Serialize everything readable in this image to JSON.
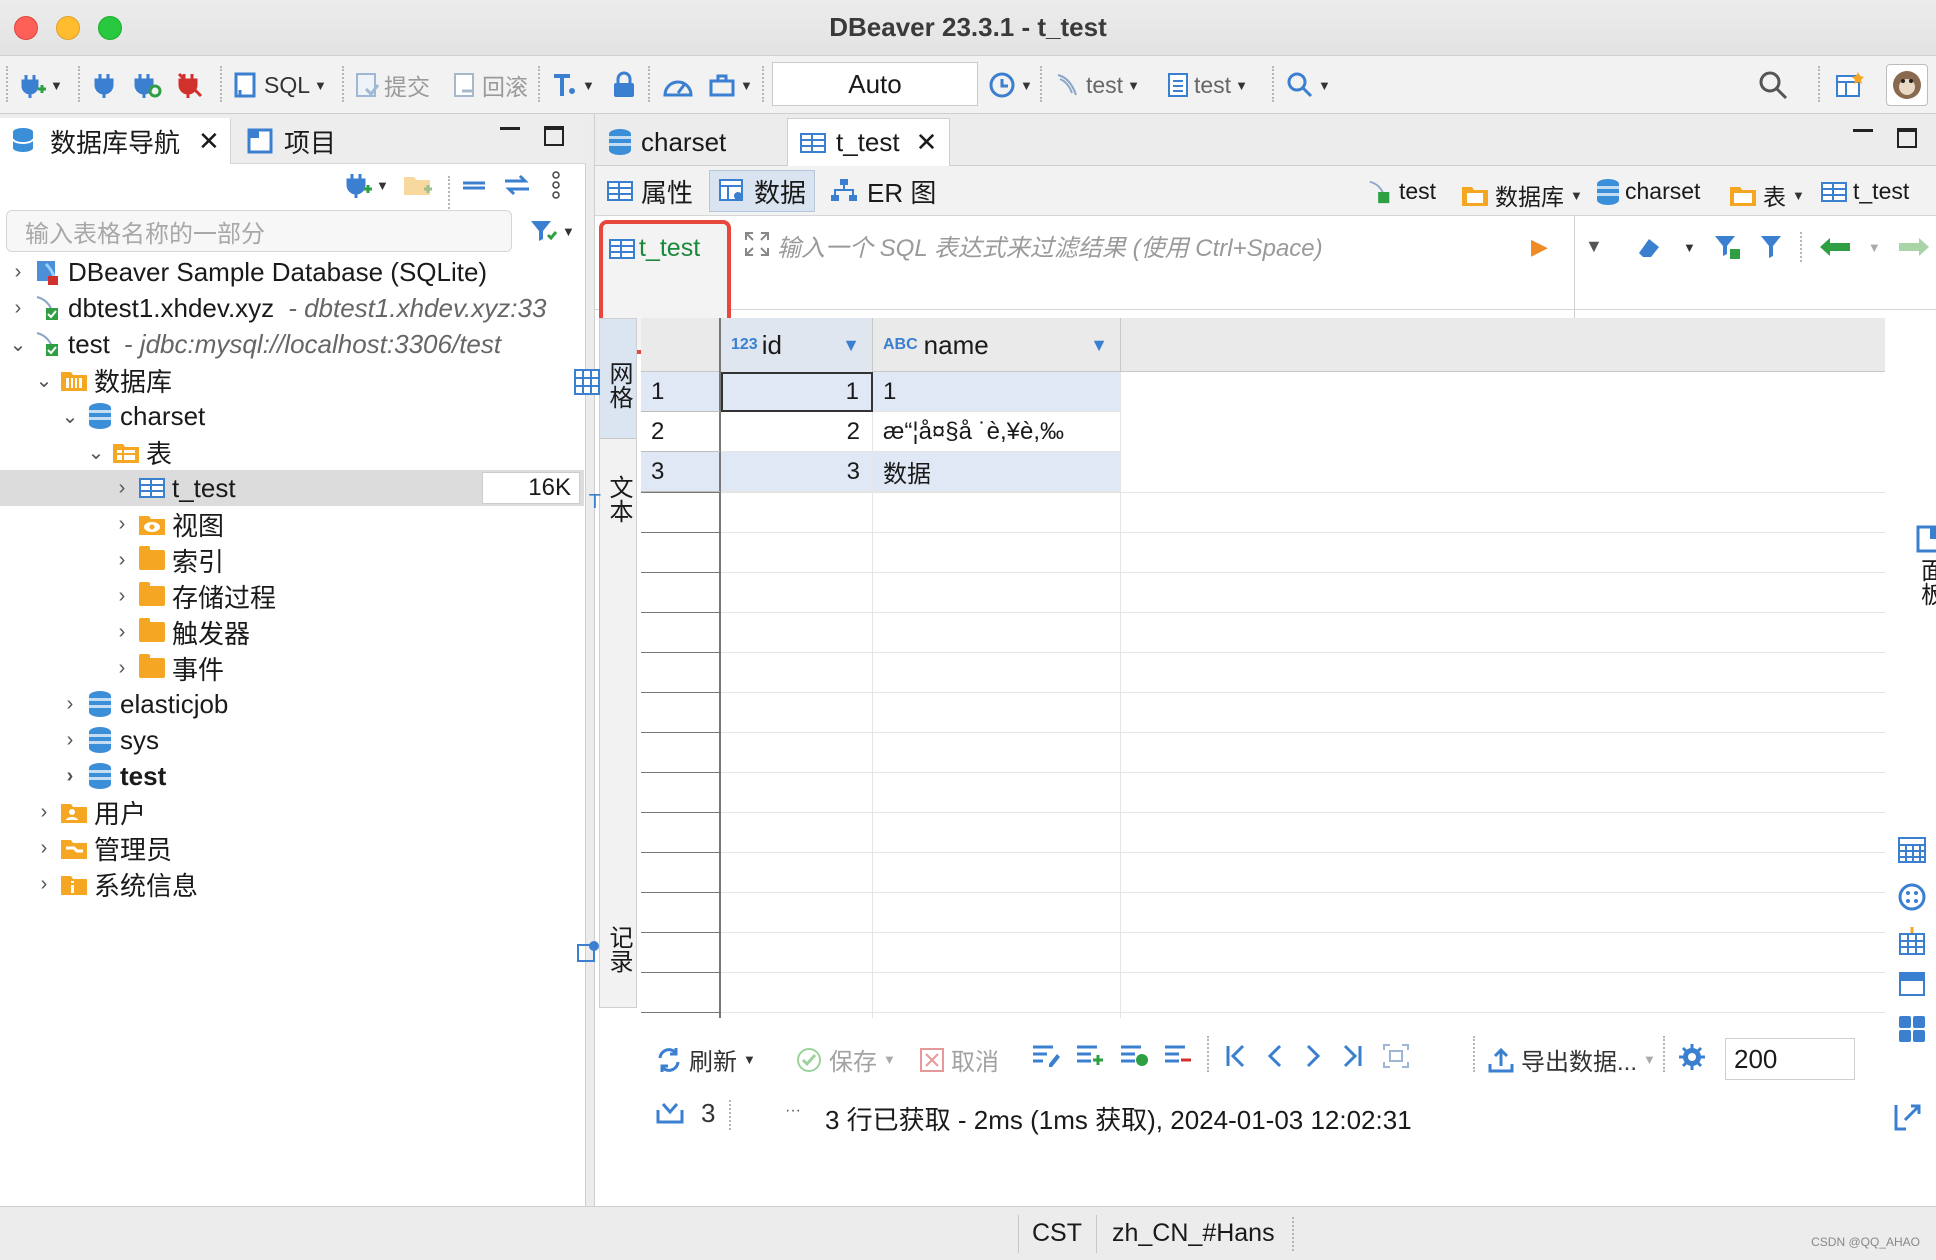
{
  "window": {
    "title": "DBeaver 23.3.1 - t_test"
  },
  "toolbar": {
    "sql_label": "SQL",
    "commit_label": "提交",
    "rollback_label": "回滚",
    "transaction_mode": "Auto",
    "datasource_label": "test",
    "schema_label": "test"
  },
  "left_panel": {
    "tabs": [
      {
        "label": "数据库导航"
      },
      {
        "label": "项目"
      }
    ],
    "search_placeholder": "输入表格名称的一部分",
    "tree": [
      {
        "label": "DBeaver Sample Database (SQLite)",
        "sub": ""
      },
      {
        "label": "dbtest1.xhdev.xyz",
        "sub": "- dbtest1.xhdev.xyz:33"
      },
      {
        "label": "test",
        "sub": "- jdbc:mysql://localhost:3306/test"
      },
      {
        "label": "数据库"
      },
      {
        "label": "charset"
      },
      {
        "label": "表"
      },
      {
        "label": "t_test",
        "size": "16K"
      },
      {
        "label": "视图"
      },
      {
        "label": "索引"
      },
      {
        "label": "存储过程"
      },
      {
        "label": "触发器"
      },
      {
        "label": "事件"
      },
      {
        "label": "elasticjob"
      },
      {
        "label": "sys"
      },
      {
        "label": "test"
      },
      {
        "label": "用户"
      },
      {
        "label": "管理员"
      },
      {
        "label": "系统信息"
      }
    ]
  },
  "editor": {
    "tabs": [
      {
        "label": "charset"
      },
      {
        "label": "t_test"
      }
    ],
    "sub_tabs": [
      {
        "label": "属性"
      },
      {
        "label": "数据"
      },
      {
        "label": "ER 图"
      }
    ],
    "breadcrumb": [
      "test",
      "数据库",
      "charset",
      "表",
      "t_test"
    ],
    "table_name": "t_test",
    "filter_placeholder": "输入一个 SQL 表达式来过滤结果 (使用 Ctrl+Space)",
    "left_vtabs": [
      "网格",
      "文本",
      "记录"
    ],
    "right_vtab": "面板",
    "columns": [
      {
        "type": "123",
        "name": "id"
      },
      {
        "type": "ABC",
        "name": "name"
      }
    ],
    "rows": [
      {
        "num": "1",
        "id": "1",
        "name": "1"
      },
      {
        "num": "2",
        "id": "2",
        "name": "æ“¦å¤§å ˙è,¥è,‰"
      },
      {
        "num": "3",
        "id": "3",
        "name": "数据"
      }
    ],
    "bottom": {
      "refresh": "刷新",
      "save": "保存",
      "cancel": "取消",
      "export": "导出数据...",
      "limit": "200",
      "row_count": "3",
      "ellipsis": "···",
      "status": "3 行已获取 - 2ms (1ms 获取), 2024-01-03 12:02:31"
    }
  },
  "statusbar": {
    "timezone": "CST",
    "locale": "zh_CN_#Hans",
    "watermark": "CSDN @QQ_AHAO"
  }
}
